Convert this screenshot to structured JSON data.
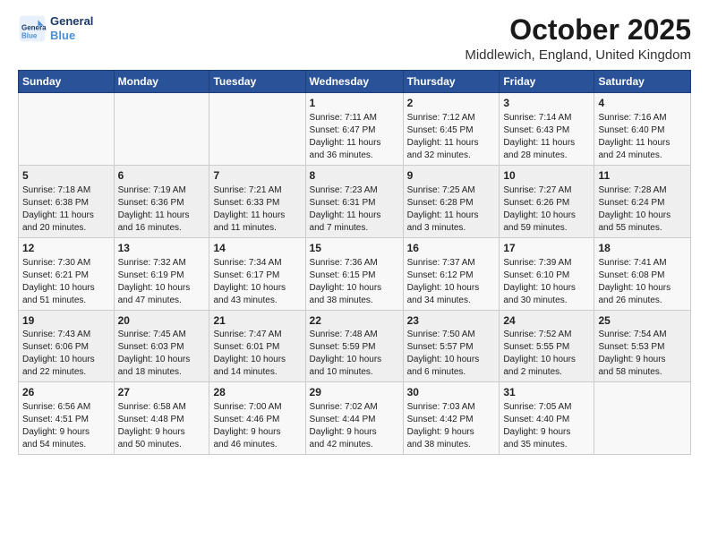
{
  "logo": {
    "line1": "General",
    "line2": "Blue"
  },
  "title": "October 2025",
  "location": "Middlewich, England, United Kingdom",
  "weekdays": [
    "Sunday",
    "Monday",
    "Tuesday",
    "Wednesday",
    "Thursday",
    "Friday",
    "Saturday"
  ],
  "weeks": [
    [
      {
        "day": "",
        "content": ""
      },
      {
        "day": "",
        "content": ""
      },
      {
        "day": "",
        "content": ""
      },
      {
        "day": "1",
        "content": "Sunrise: 7:11 AM\nSunset: 6:47 PM\nDaylight: 11 hours\nand 36 minutes."
      },
      {
        "day": "2",
        "content": "Sunrise: 7:12 AM\nSunset: 6:45 PM\nDaylight: 11 hours\nand 32 minutes."
      },
      {
        "day": "3",
        "content": "Sunrise: 7:14 AM\nSunset: 6:43 PM\nDaylight: 11 hours\nand 28 minutes."
      },
      {
        "day": "4",
        "content": "Sunrise: 7:16 AM\nSunset: 6:40 PM\nDaylight: 11 hours\nand 24 minutes."
      }
    ],
    [
      {
        "day": "5",
        "content": "Sunrise: 7:18 AM\nSunset: 6:38 PM\nDaylight: 11 hours\nand 20 minutes."
      },
      {
        "day": "6",
        "content": "Sunrise: 7:19 AM\nSunset: 6:36 PM\nDaylight: 11 hours\nand 16 minutes."
      },
      {
        "day": "7",
        "content": "Sunrise: 7:21 AM\nSunset: 6:33 PM\nDaylight: 11 hours\nand 11 minutes."
      },
      {
        "day": "8",
        "content": "Sunrise: 7:23 AM\nSunset: 6:31 PM\nDaylight: 11 hours\nand 7 minutes."
      },
      {
        "day": "9",
        "content": "Sunrise: 7:25 AM\nSunset: 6:28 PM\nDaylight: 11 hours\nand 3 minutes."
      },
      {
        "day": "10",
        "content": "Sunrise: 7:27 AM\nSunset: 6:26 PM\nDaylight: 10 hours\nand 59 minutes."
      },
      {
        "day": "11",
        "content": "Sunrise: 7:28 AM\nSunset: 6:24 PM\nDaylight: 10 hours\nand 55 minutes."
      }
    ],
    [
      {
        "day": "12",
        "content": "Sunrise: 7:30 AM\nSunset: 6:21 PM\nDaylight: 10 hours\nand 51 minutes."
      },
      {
        "day": "13",
        "content": "Sunrise: 7:32 AM\nSunset: 6:19 PM\nDaylight: 10 hours\nand 47 minutes."
      },
      {
        "day": "14",
        "content": "Sunrise: 7:34 AM\nSunset: 6:17 PM\nDaylight: 10 hours\nand 43 minutes."
      },
      {
        "day": "15",
        "content": "Sunrise: 7:36 AM\nSunset: 6:15 PM\nDaylight: 10 hours\nand 38 minutes."
      },
      {
        "day": "16",
        "content": "Sunrise: 7:37 AM\nSunset: 6:12 PM\nDaylight: 10 hours\nand 34 minutes."
      },
      {
        "day": "17",
        "content": "Sunrise: 7:39 AM\nSunset: 6:10 PM\nDaylight: 10 hours\nand 30 minutes."
      },
      {
        "day": "18",
        "content": "Sunrise: 7:41 AM\nSunset: 6:08 PM\nDaylight: 10 hours\nand 26 minutes."
      }
    ],
    [
      {
        "day": "19",
        "content": "Sunrise: 7:43 AM\nSunset: 6:06 PM\nDaylight: 10 hours\nand 22 minutes."
      },
      {
        "day": "20",
        "content": "Sunrise: 7:45 AM\nSunset: 6:03 PM\nDaylight: 10 hours\nand 18 minutes."
      },
      {
        "day": "21",
        "content": "Sunrise: 7:47 AM\nSunset: 6:01 PM\nDaylight: 10 hours\nand 14 minutes."
      },
      {
        "day": "22",
        "content": "Sunrise: 7:48 AM\nSunset: 5:59 PM\nDaylight: 10 hours\nand 10 minutes."
      },
      {
        "day": "23",
        "content": "Sunrise: 7:50 AM\nSunset: 5:57 PM\nDaylight: 10 hours\nand 6 minutes."
      },
      {
        "day": "24",
        "content": "Sunrise: 7:52 AM\nSunset: 5:55 PM\nDaylight: 10 hours\nand 2 minutes."
      },
      {
        "day": "25",
        "content": "Sunrise: 7:54 AM\nSunset: 5:53 PM\nDaylight: 9 hours\nand 58 minutes."
      }
    ],
    [
      {
        "day": "26",
        "content": "Sunrise: 6:56 AM\nSunset: 4:51 PM\nDaylight: 9 hours\nand 54 minutes."
      },
      {
        "day": "27",
        "content": "Sunrise: 6:58 AM\nSunset: 4:48 PM\nDaylight: 9 hours\nand 50 minutes."
      },
      {
        "day": "28",
        "content": "Sunrise: 7:00 AM\nSunset: 4:46 PM\nDaylight: 9 hours\nand 46 minutes."
      },
      {
        "day": "29",
        "content": "Sunrise: 7:02 AM\nSunset: 4:44 PM\nDaylight: 9 hours\nand 42 minutes."
      },
      {
        "day": "30",
        "content": "Sunrise: 7:03 AM\nSunset: 4:42 PM\nDaylight: 9 hours\nand 38 minutes."
      },
      {
        "day": "31",
        "content": "Sunrise: 7:05 AM\nSunset: 4:40 PM\nDaylight: 9 hours\nand 35 minutes."
      },
      {
        "day": "",
        "content": ""
      }
    ]
  ]
}
